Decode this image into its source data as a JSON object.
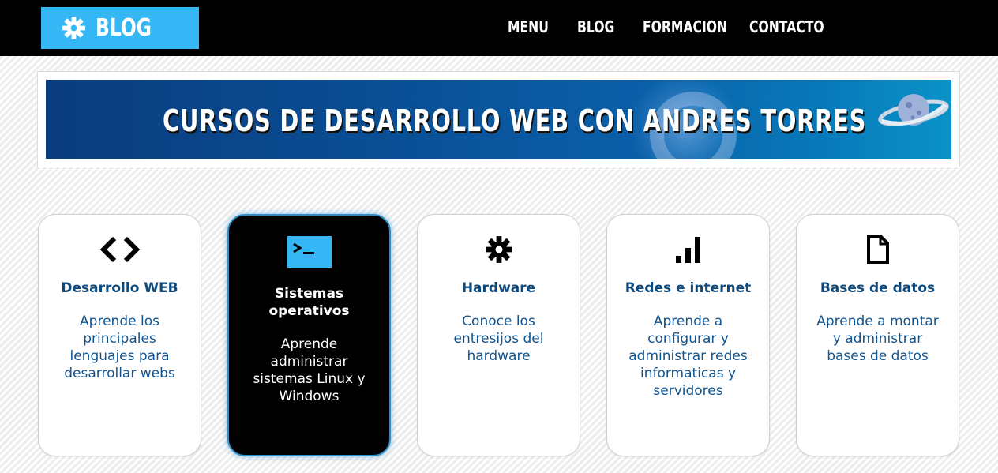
{
  "header": {
    "logo_text": "BLOG",
    "nav": [
      "MENU",
      "BLOG",
      "FORMACION",
      "CONTACTO"
    ]
  },
  "banner": {
    "title": "CURSOS DE DESARROLLO WEB CON ANDRES TORRES"
  },
  "cards": [
    {
      "icon": "code-icon",
      "title": "Desarrollo WEB",
      "description": "Aprende los principales lenguajes para desarrollar webs"
    },
    {
      "icon": "terminal-icon",
      "title": "Sistemas operativos",
      "description": "Aprende administrar sistemas Linux y Windows"
    },
    {
      "icon": "gear-icon",
      "title": "Hardware",
      "description": "Conoce los entresijos del hardware"
    },
    {
      "icon": "signal-icon",
      "title": "Redes e internet",
      "description": "Aprende a configurar y administrar redes informaticas y servidores"
    },
    {
      "icon": "document-icon",
      "title": "Bases de datos",
      "description": "Aprende a montar y administrar bases de datos"
    }
  ],
  "colors": {
    "accent": "#35b7f5",
    "header_bg": "#000000",
    "card_text": "#0d4a7d"
  }
}
